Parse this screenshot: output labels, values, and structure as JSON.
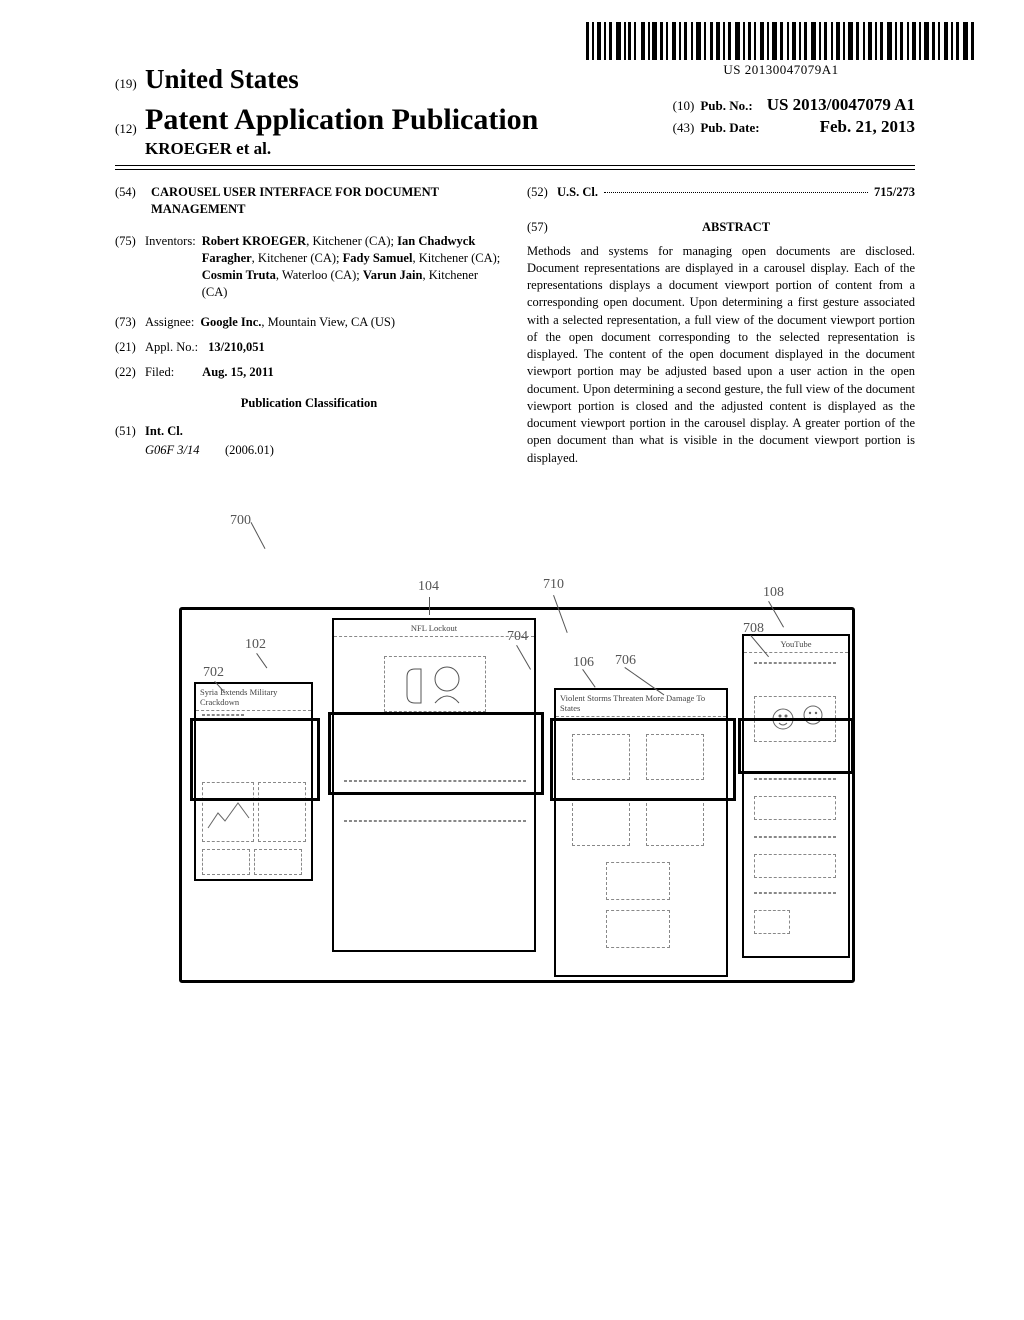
{
  "barcode_text": "US 20130047079A1",
  "header": {
    "country_num": "(19)",
    "country": "United States",
    "pub_type_num": "(12)",
    "pub_type": "Patent Application Publication",
    "pub_no_num": "(10)",
    "pub_no_label": "Pub. No.:",
    "pub_no_value": "US 2013/0047079 A1",
    "pub_date_num": "(43)",
    "pub_date_label": "Pub. Date:",
    "pub_date_value": "Feb. 21, 2013",
    "authors": "KROEGER et al."
  },
  "left_col": {
    "title_num": "(54)",
    "title": "CAROUSEL USER INTERFACE FOR DOCUMENT MANAGEMENT",
    "inventors_num": "(75)",
    "inventors_label": "Inventors:",
    "inventors_html": "Robert KROEGER, Kitchener (CA); Ian Chadwyck Faragher, Kitchener (CA); Fady Samuel, Kitchener (CA); Cosmin Truta, Waterloo (CA); Varun Jain, Kitchener (CA)",
    "assignee_num": "(73)",
    "assignee_label": "Assignee:",
    "assignee_value": "Google Inc., Mountain View, CA (US)",
    "appl_num": "(21)",
    "appl_label": "Appl. No.:",
    "appl_value": "13/210,051",
    "filed_num": "(22)",
    "filed_label": "Filed:",
    "filed_value": "Aug. 15, 2011",
    "class_head": "Publication Classification",
    "intcl_num": "(51)",
    "intcl_label": "Int. Cl.",
    "intcl_code": "G06F 3/14",
    "intcl_date": "(2006.01)"
  },
  "right_col": {
    "uscl_num": "(52)",
    "uscl_label": "U.S. Cl.",
    "uscl_value": "715/273",
    "abstract_num": "(57)",
    "abstract_head": "ABSTRACT",
    "abstract_text": "Methods and systems for managing open documents are disclosed. Document representations are displayed in a carousel display. Each of the representations displays a document viewport portion of content from a corresponding open document. Upon determining a first gesture associated with a selected representation, a full view of the document viewport portion of the open document corresponding to the selected representation is displayed. The content of the open document displayed in the document viewport portion may be adjusted based upon a user action in the open document. Upon determining a second gesture, the full view of the document viewport portion is closed and the adjusted content is displayed as the document viewport portion in the carousel display. A greater portion of the open document than what is visible in the document viewport portion is displayed."
  },
  "figure": {
    "labels": {
      "r700": "700",
      "r104": "104",
      "r710": "710",
      "r108": "108",
      "r102": "102",
      "r702": "702",
      "r704": "704",
      "r106": "106",
      "r706": "706",
      "r708": "708"
    },
    "tiles": {
      "t1_title": "Syria Extends Military Crackdown",
      "t2_title": "NFL Lockout",
      "t3_title": "Violent Storms Threaten More Damage To States",
      "t4_title": "YouTube"
    }
  }
}
